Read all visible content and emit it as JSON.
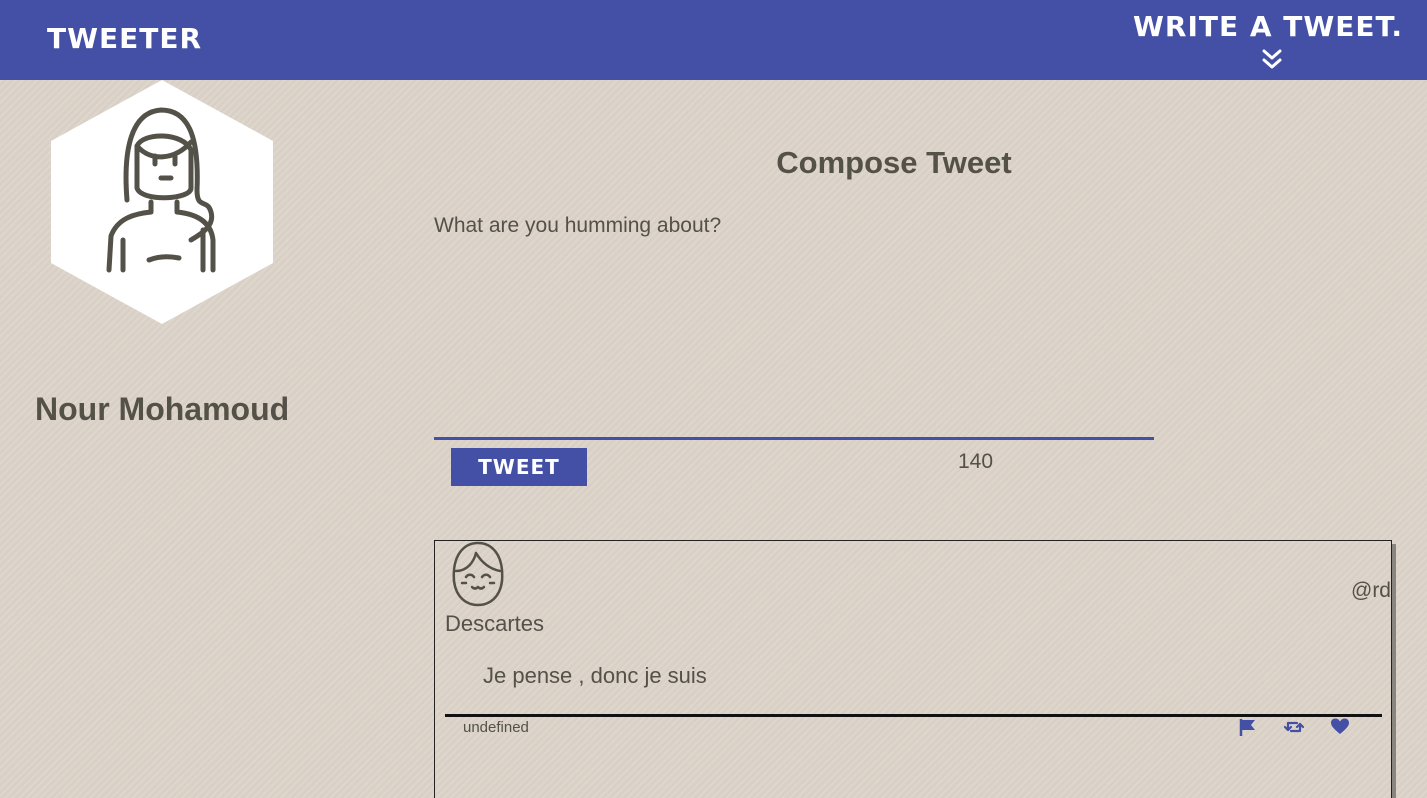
{
  "nav": {
    "brand": "TWEETER",
    "write_cta": "WRITE A TWEET.",
    "write_cta_icon": "double-chevron-down-icon"
  },
  "profile": {
    "name": "Nour Mohamoud",
    "avatar_icon": "user-avatar-icon"
  },
  "compose": {
    "title": "Compose Tweet",
    "placeholder": "What are you humming about?",
    "button_label": "TWEET",
    "counter": "140"
  },
  "tweets": [
    {
      "handle": "@rd",
      "author": "Descartes",
      "text": "Je pense , donc je suis",
      "date": "undefined",
      "actions": [
        "flag-icon",
        "retweet-icon",
        "heart-icon"
      ]
    }
  ],
  "colors": {
    "accent": "#4450a5",
    "text": "#545149",
    "background": "#dcd3c9"
  }
}
